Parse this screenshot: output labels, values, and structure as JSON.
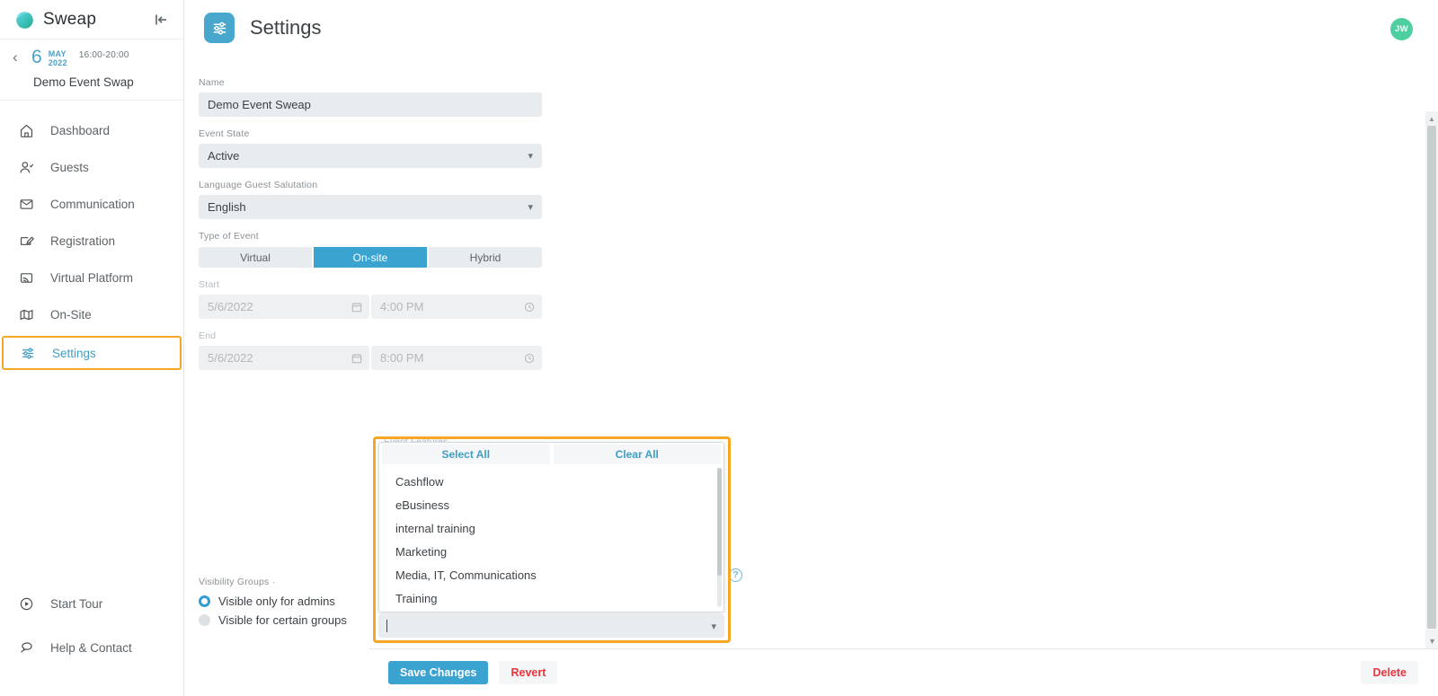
{
  "brand": {
    "name": "Sweap",
    "accent": "#3ba3d0",
    "highlight": "#f5a623"
  },
  "sidebar": {
    "collapse_icon": "collapse-left-icon",
    "event": {
      "back_icon": "chevron-left-icon",
      "day": "6",
      "month": "MAY",
      "year": "2022",
      "time_range": "16:00-20:00",
      "name": "Demo Event Swap"
    },
    "items": [
      {
        "label": "Dashboard",
        "icon": "home-icon",
        "active": false
      },
      {
        "label": "Guests",
        "icon": "user-check-icon",
        "active": false
      },
      {
        "label": "Communication",
        "icon": "envelope-icon",
        "active": false
      },
      {
        "label": "Registration",
        "icon": "form-edit-icon",
        "active": false
      },
      {
        "label": "Virtual Platform",
        "icon": "screencast-icon",
        "active": false
      },
      {
        "label": "On-Site",
        "icon": "map-pin-icon",
        "active": false
      },
      {
        "label": "Settings",
        "icon": "sliders-icon",
        "active": true
      }
    ],
    "bottom_items": [
      {
        "label": "Start Tour",
        "icon": "play-circle-icon"
      },
      {
        "label": "Help & Contact",
        "icon": "chat-bubbles-icon"
      }
    ]
  },
  "header": {
    "title": "Settings",
    "icon": "sliders-icon",
    "avatar_initials": "JW"
  },
  "form": {
    "name": {
      "label": "Name",
      "value": "Demo Event Sweap"
    },
    "event_state": {
      "label": "Event State",
      "value": "Active"
    },
    "language": {
      "label": "Language Guest Salutation",
      "value": "English"
    },
    "type_of_event": {
      "label": "Type of Event",
      "options": [
        "Virtual",
        "On-site",
        "Hybrid"
      ],
      "selected": "On-site"
    },
    "start": {
      "label": "Start",
      "date": "5/6/2022",
      "time": "4:00 PM"
    },
    "end": {
      "label": "End",
      "date": "5/6/2022",
      "time": "8:00 PM"
    },
    "event_features": {
      "label": "Event Features",
      "select_all": "Select All",
      "clear_all": "Clear All",
      "options": [
        "Cashflow",
        "eBusiness",
        "internal training",
        "Marketing",
        "Media, IT, Communications",
        "Training"
      ],
      "input_value": ""
    },
    "visibility_groups": {
      "label": "Visibility Groups ·",
      "options": [
        {
          "label": "Visible only for admins",
          "selected": true
        },
        {
          "label": "Visible for certain groups",
          "selected": false
        }
      ]
    }
  },
  "actions": {
    "save": "Save Changes",
    "revert": "Revert",
    "delete": "Delete"
  }
}
